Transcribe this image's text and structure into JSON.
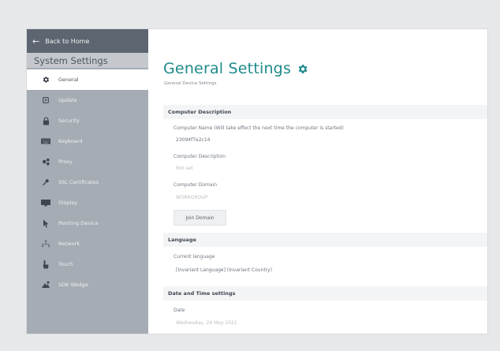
{
  "sidebar": {
    "back_label": "Back to Home",
    "title": "System Settings",
    "items": [
      {
        "label": "General",
        "icon": "gear-icon"
      },
      {
        "label": "Update",
        "icon": "update-icon"
      },
      {
        "label": "Security",
        "icon": "lock-icon"
      },
      {
        "label": "Keyboard",
        "icon": "keyboard-icon"
      },
      {
        "label": "Proxy",
        "icon": "proxy-icon"
      },
      {
        "label": "SSL Certificates",
        "icon": "certificate-icon"
      },
      {
        "label": "Display",
        "icon": "display-icon"
      },
      {
        "label": "Pointing Device",
        "icon": "pointer-icon"
      },
      {
        "label": "Network",
        "icon": "network-icon"
      },
      {
        "label": "Touch",
        "icon": "touch-icon"
      },
      {
        "label": "SDK Wedge",
        "icon": "wedge-icon"
      }
    ]
  },
  "header": {
    "title": "General Settings",
    "subtitle": "General Device Settings"
  },
  "computer": {
    "section_title": "Computer Description",
    "name_label": "Computer Name (Will take effect the next time the computer is started)",
    "name_value": "23094f7e2c14",
    "description_label": "Computer Description",
    "description_value": "Not set",
    "domain_label": "Computer Domain",
    "domain_value": "WORKGROUP",
    "join_button": "Join Domain"
  },
  "language": {
    "section_title": "Language",
    "current_label": "Current language",
    "current_value": "[Invariant Language] (Invariant Country)"
  },
  "datetime": {
    "section_title": "Date and Time settings",
    "date_label": "Date",
    "date_value": "Wednesday, 26 May 2021"
  },
  "colors": {
    "accent": "#1f8a8a",
    "sidebar_bg": "#a6acb4",
    "sidebar_header_bg": "#5d6670"
  }
}
